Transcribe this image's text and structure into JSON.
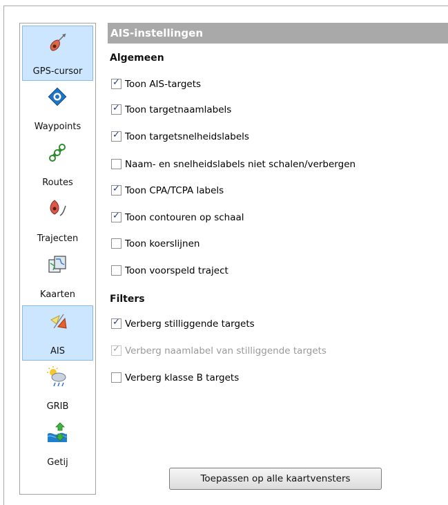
{
  "sidebar": {
    "items": [
      {
        "label": "GPS-cursor",
        "icon": "gps-cursor-icon",
        "selected": true
      },
      {
        "label": "Waypoints",
        "icon": "waypoint-icon",
        "selected": false
      },
      {
        "label": "Routes",
        "icon": "route-icon",
        "selected": false
      },
      {
        "label": "Trajecten",
        "icon": "track-icon",
        "selected": false
      },
      {
        "label": "Kaarten",
        "icon": "charts-icon",
        "selected": false
      },
      {
        "label": "AIS",
        "icon": "ais-icon",
        "selected": true
      },
      {
        "label": "GRIB",
        "icon": "grib-weather-icon",
        "selected": false
      },
      {
        "label": "Getij",
        "icon": "tide-icon",
        "selected": false
      }
    ]
  },
  "panel": {
    "title": "AIS-instellingen",
    "sections": {
      "general": {
        "title": "Algemeen",
        "options": [
          {
            "label": "Toon AIS-targets",
            "checked": true,
            "enabled": true
          },
          {
            "label": "Toon targetnaamlabels",
            "checked": true,
            "enabled": true
          },
          {
            "label": "Toon targetsnelheidslabels",
            "checked": true,
            "enabled": true
          },
          {
            "label": "Naam- en snelheidslabels niet schalen/verbergen",
            "checked": false,
            "enabled": true
          },
          {
            "label": "Toon CPA/TCPA labels",
            "checked": true,
            "enabled": true
          },
          {
            "label": "Toon contouren op schaal",
            "checked": true,
            "enabled": true
          },
          {
            "label": "Toon koerslijnen",
            "checked": false,
            "enabled": true
          },
          {
            "label": "Toon voorspeld traject",
            "checked": false,
            "enabled": true
          }
        ]
      },
      "filters": {
        "title": "Filters",
        "options": [
          {
            "label": "Verberg stilliggende targets",
            "checked": true,
            "enabled": true
          },
          {
            "label": "Verberg naamlabel van stilliggende targets",
            "checked": true,
            "enabled": false
          },
          {
            "label": "Verberg klasse B targets",
            "checked": false,
            "enabled": true
          }
        ]
      }
    },
    "apply_button": "Toepassen op alle kaartvensters"
  },
  "colors": {
    "title_bar": "#a9a9a9",
    "selection": "#cce6ff",
    "check": "#1c3e8e"
  }
}
